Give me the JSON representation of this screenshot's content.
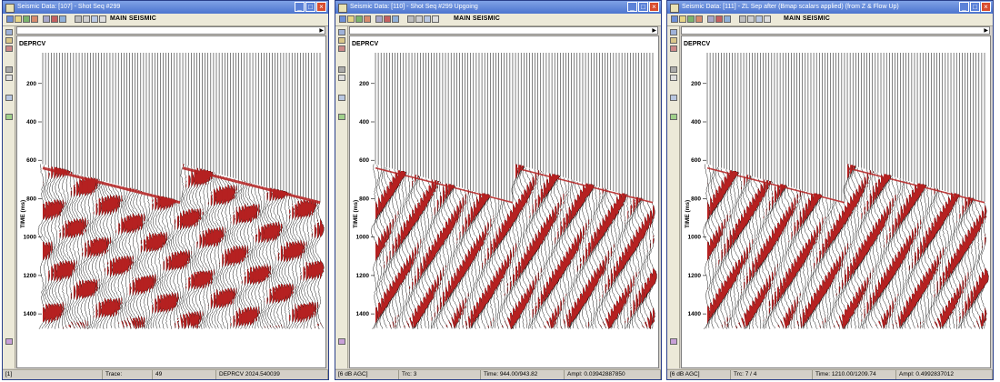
{
  "windows": [
    {
      "title": "Seismic Data: [107] - Shot Seq #299",
      "toolbar_label": "MAIN SEISMIC",
      "channel": "DEPRCV",
      "axis_label": "TIME (ms)",
      "ticks": [
        "200",
        "400",
        "600",
        "800",
        "1000",
        "1200",
        "1400"
      ],
      "status": [
        "[1]",
        "Trace:",
        "49",
        "DEPRCV 2024.540039"
      ]
    },
    {
      "title": "Seismic Data: [110] - Shot Seq #299 Upgoing",
      "toolbar_label": "MAIN SEISMIC",
      "channel": "DEPRCV",
      "axis_label": "TIME (ms)",
      "ticks": [
        "200",
        "400",
        "600",
        "800",
        "1000",
        "1200",
        "1400"
      ],
      "status": [
        "[6 dB AGC]",
        "Trc: 3",
        "Time: 944.00/943.82",
        "Ampl: 0.03942887850"
      ]
    },
    {
      "title": "Seismic Data: [111] - ZL Sep after (Bmap scalars applied) (from Z & Flow Up)",
      "toolbar_label": "MAIN SEISMIC",
      "channel": "DEPRCV",
      "axis_label": "TIME (ms)",
      "ticks": [
        "200",
        "400",
        "600",
        "800",
        "1000",
        "1200",
        "1400"
      ],
      "status": [
        "[6 dB AGC]",
        "Trc: 7 / 4",
        "Time: 1210.00/1209.74",
        "Ampl: 0.4992837012"
      ]
    }
  ],
  "colors": {
    "wiggle_fill": "#b52121",
    "title_bar": "#4c74cf"
  },
  "icons": {
    "minimize": "minimize-icon",
    "maximize": "maximize-icon",
    "close": "close-icon"
  }
}
